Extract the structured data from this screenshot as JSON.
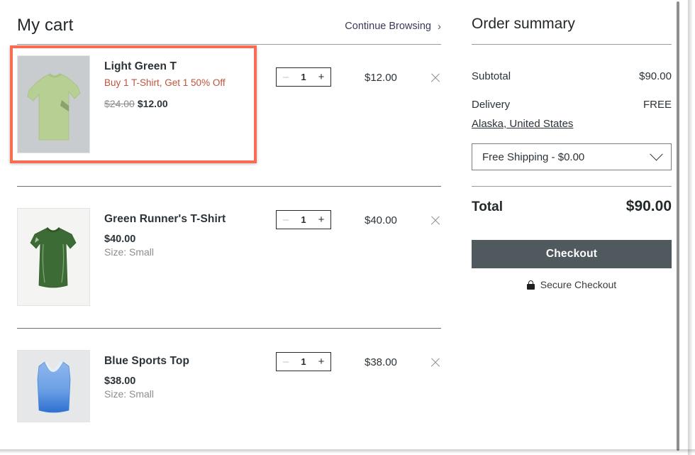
{
  "cart": {
    "title": "My cart",
    "continue_browsing": "Continue Browsing",
    "chevron": "›",
    "items": [
      {
        "name": "Light Green T",
        "promo": "Buy 1 T-Shirt, Get 1 50% Off",
        "price_old": "$24.00",
        "price_new": "$12.00",
        "variant": "",
        "quantity": "1",
        "line_price": "$12.00",
        "minus": "–",
        "plus": "+",
        "highlighted": true,
        "image": "light-green-oversized-tshirt"
      },
      {
        "name": "Green Runner's T-Shirt",
        "promo": "",
        "price_old": "",
        "price_new": "$40.00",
        "variant": "Size: Small",
        "quantity": "1",
        "line_price": "$40.00",
        "minus": "–",
        "plus": "+",
        "highlighted": false,
        "image": "green-runners-tshirt"
      },
      {
        "name": "Blue Sports Top",
        "promo": "",
        "price_old": "",
        "price_new": "$38.00",
        "variant": "Size: Small",
        "quantity": "1",
        "line_price": "$38.00",
        "minus": "–",
        "plus": "+",
        "highlighted": false,
        "image": "blue-sports-top"
      }
    ]
  },
  "summary": {
    "title": "Order summary",
    "subtotal_label": "Subtotal",
    "subtotal_value": "$90.00",
    "delivery_label": "Delivery",
    "delivery_value": "FREE",
    "delivery_location": "Alaska, United States",
    "shipping_option": "Free Shipping - $0.00",
    "total_label": "Total",
    "total_value": "$90.00",
    "checkout_label": "Checkout",
    "secure_checkout_label": "Secure Checkout"
  },
  "colors": {
    "highlight_border": "#fa6c51",
    "promo_text": "#c0533c",
    "checkout_bg": "#50595e",
    "muted_text": "#8d8d8d"
  }
}
